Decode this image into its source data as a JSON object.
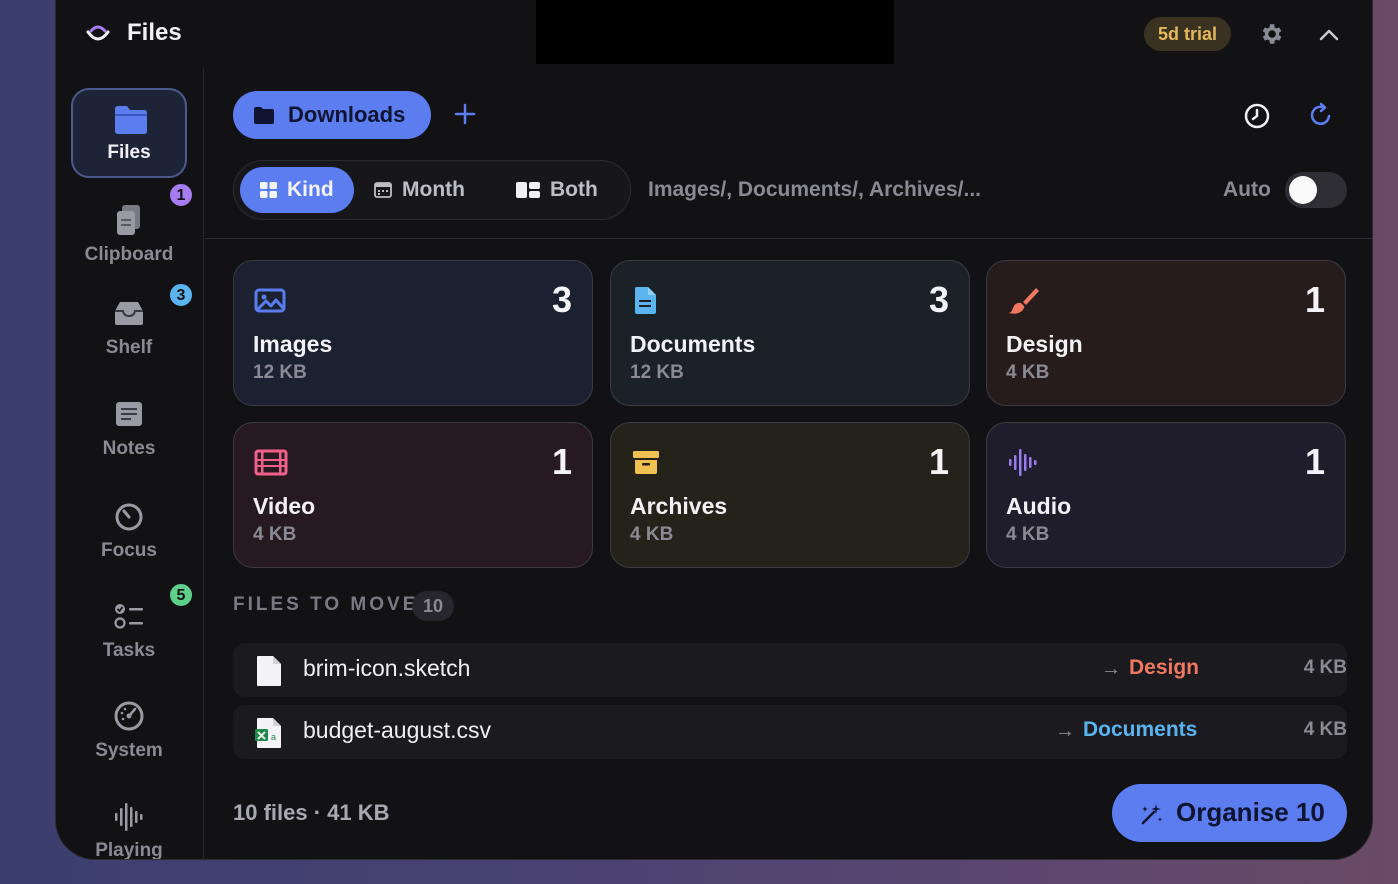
{
  "app": {
    "title": "Files",
    "trial": "5d trial"
  },
  "sidebar": {
    "items": [
      {
        "label": "Files",
        "icon": "folder-icon",
        "active": true
      },
      {
        "label": "Clipboard",
        "icon": "clipboard-icon",
        "badge": "1",
        "badge_color": "#a77cf0"
      },
      {
        "label": "Shelf",
        "icon": "tray-icon",
        "badge": "3",
        "badge_color": "#5ab4f0"
      },
      {
        "label": "Notes",
        "icon": "notes-icon"
      },
      {
        "label": "Focus",
        "icon": "timer-icon"
      },
      {
        "label": "Tasks",
        "icon": "tasks-icon",
        "badge": "5",
        "badge_color": "#5ed08a"
      },
      {
        "label": "System",
        "icon": "gauge-icon"
      },
      {
        "label": "Playing",
        "icon": "waveform-icon"
      }
    ]
  },
  "toolbar": {
    "folder": "Downloads"
  },
  "group_by": {
    "options": [
      {
        "label": "Kind",
        "active": true
      },
      {
        "label": "Month",
        "active": false
      },
      {
        "label": "Both",
        "active": false
      }
    ],
    "path_preview": "Images/, Documents/, Archives/...",
    "auto_label": "Auto",
    "auto_enabled": false
  },
  "categories": [
    {
      "name": "Images",
      "count": "3",
      "size": "12 KB",
      "icon": "image-icon",
      "color": "#5b7df0",
      "bg": "#1b2130"
    },
    {
      "name": "Documents",
      "count": "3",
      "size": "12 KB",
      "icon": "document-icon",
      "color": "#5ab4f0",
      "bg": "#1a2228"
    },
    {
      "name": "Design",
      "count": "1",
      "size": "4 KB",
      "icon": "brush-icon",
      "color": "#f07860",
      "bg": "#261c1c"
    },
    {
      "name": "Video",
      "count": "1",
      "size": "4 KB",
      "icon": "film-icon",
      "color": "#f0608a",
      "bg": "#261a20"
    },
    {
      "name": "Archives",
      "count": "1",
      "size": "4 KB",
      "icon": "archive-icon",
      "color": "#f0c050",
      "bg": "#25221a"
    },
    {
      "name": "Audio",
      "count": "1",
      "size": "4 KB",
      "icon": "waveform-icon",
      "color": "#9a7cf0",
      "bg": "#1f1c2c"
    }
  ],
  "files_section": {
    "title": "FILES TO MOVE",
    "count": "10"
  },
  "files": [
    {
      "name": "brim-icon.sketch",
      "dest": "Design",
      "dest_color": "#f07860",
      "size": "4 KB",
      "icon": "file-icon"
    },
    {
      "name": "budget-august.csv",
      "dest": "Documents",
      "dest_color": "#5ab4f0",
      "size": "4 KB",
      "icon": "spreadsheet-icon"
    }
  ],
  "footer": {
    "summary": "10 files · 41 KB",
    "organise_label": "Organise 10"
  }
}
